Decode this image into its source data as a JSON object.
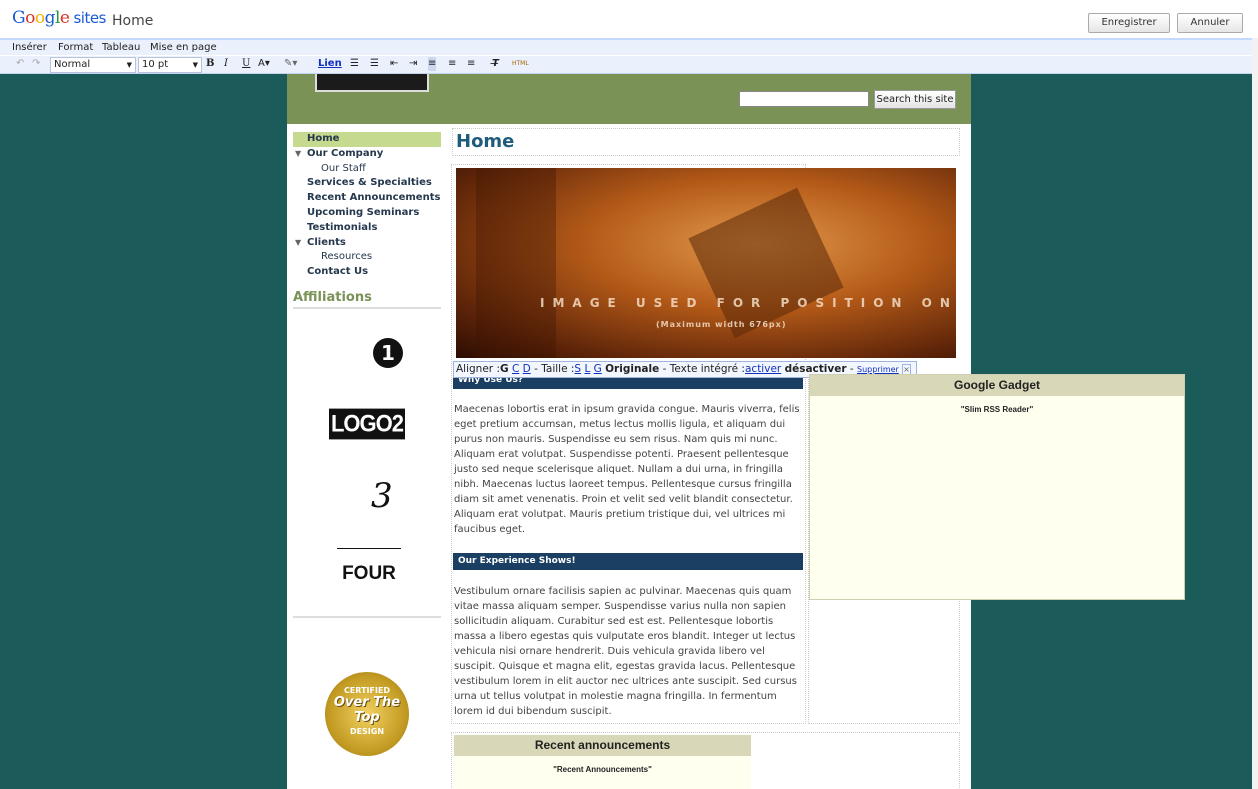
{
  "app": {
    "brand": "Google sites",
    "page_name": "Home"
  },
  "top_buttons": {
    "save": "Enregistrer",
    "cancel": "Annuler"
  },
  "menu": [
    "Insérer",
    "Format",
    "Tableau",
    "Mise en page"
  ],
  "toolbar": {
    "style": "Normal",
    "size": "10 pt",
    "bold": "B",
    "italic": "I",
    "underline": "U",
    "link": "Lien",
    "html": "HTML"
  },
  "search": {
    "button": "Search this site"
  },
  "nav": [
    {
      "label": "Home",
      "level": 0
    },
    {
      "label": "Our Company",
      "level": 0
    },
    {
      "label": "Our Staff",
      "level": 1
    },
    {
      "label": "Services & Specialties",
      "level": 0
    },
    {
      "label": "Recent Announcements",
      "level": 0
    },
    {
      "label": "Upcoming Seminars",
      "level": 0
    },
    {
      "label": "Testimonials",
      "level": 0
    },
    {
      "label": "Clients",
      "level": 0
    },
    {
      "label": "Resources",
      "level": 1
    },
    {
      "label": "Contact Us",
      "level": 0
    }
  ],
  "affiliations": {
    "title": "Affiliations",
    "logo2": "LOGO2",
    "logo3": "3",
    "logo4": "FOUR",
    "badge_top": "CERTIFIED",
    "badge_mid": "Over The Top",
    "badge_bottom": "DESIGN"
  },
  "main": {
    "title": "Home",
    "image_caption": "IMAGE USED FOR POSITION ONLY",
    "image_subcaption": "(Maximum width 676px)",
    "image_bar": {
      "align": "Aligner :",
      "g": "G",
      "c": "C",
      "d": "D",
      "size": "- Taille :",
      "s": "S",
      "l": "L",
      "g2": "G",
      "original": "Originale",
      "wrap": "- Texte intégré :",
      "activate": "activer",
      "deactivate": "désactiver",
      "remove": "Supprimer"
    },
    "section1_title": "Why Use Us?",
    "section1_text": "Maecenas lobortis erat in ipsum gravida congue. Mauris viverra, felis eget pretium accumsan, metus lectus mollis ligula, et aliquam dui purus non mauris. Suspendisse eu sem risus. Nam quis mi nunc. Aliquam erat volutpat. Suspendisse potenti. Praesent pellentesque justo sed neque scelerisque aliquet. Nullam a dui urna, in fringilla nibh. Maecenas luctus laoreet tempus. Pellentesque cursus fringilla diam sit amet venenatis. Proin et velit sed velit blandit consectetur. Aliquam erat volutpat. Mauris pretium tristique dui, vel ultrices mi faucibus eget.",
    "section2_title": "Our Experience Shows!",
    "section2_text": "Vestibulum ornare facilisis sapien ac pulvinar. Maecenas quis quam vitae massa aliquam semper. Suspendisse varius nulla non sapien sollicitudin aliquam. Curabitur sed est est. Pellentesque lobortis massa a libero egestas quis vulputate eros blandit. Integer ut lectus vehicula nisi ornare hendrerit. Duis vehicula gravida libero vel suscipit. Quisque et magna elit, egestas gravida lacus. Pellentesque vestibulum lorem in elit auctor nec ultrices ante suscipit. Sed cursus urna ut tellus volutpat in molestie magna fringilla. In fermentum lorem id dui bibendum suscipit."
  },
  "gadget": {
    "title": "Google Gadget",
    "subtitle": "\"Slim RSS Reader\""
  },
  "announcements": {
    "title": "Recent announcements",
    "subtitle": "\"Recent Announcements\""
  },
  "colors": {
    "canvas": "#1b5c5a",
    "header": "#7a9256",
    "nav_active": "#c5d98f",
    "section_head": "#1a3f63"
  }
}
